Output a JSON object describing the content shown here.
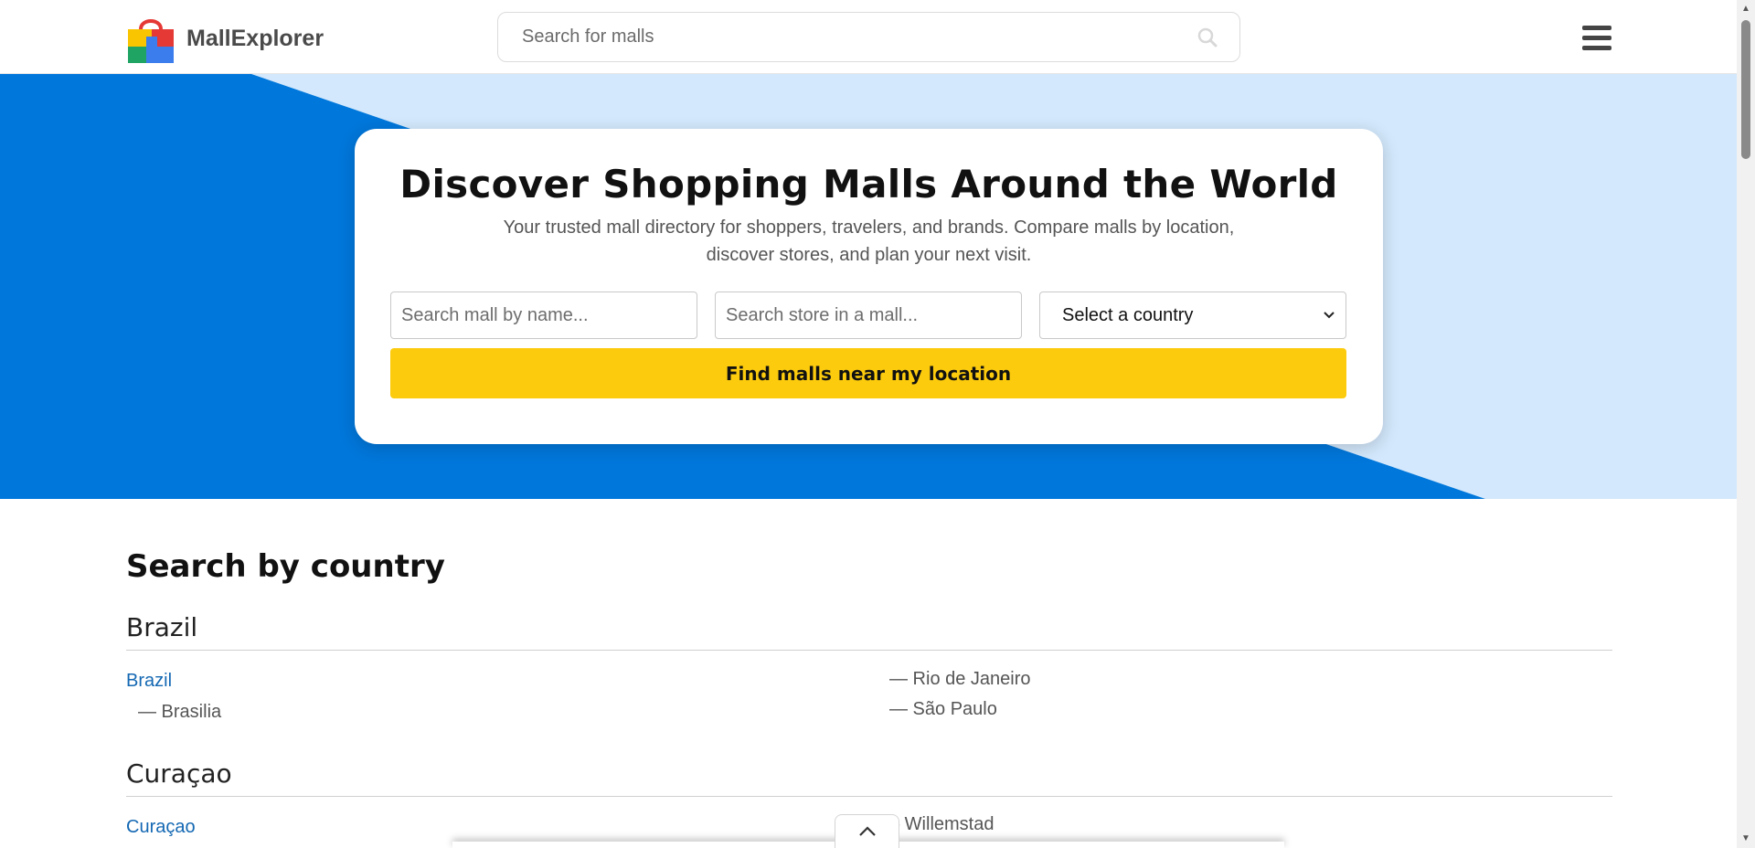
{
  "header": {
    "brand": "MallExplorer",
    "search_placeholder": "Search for malls"
  },
  "hero": {
    "title": "Discover Shopping Malls Around the World",
    "subtitle": "Your trusted mall directory for shoppers, travelers, and brands. Compare malls by location, discover stores, and plan your next visit.",
    "mall_name_placeholder": "Search mall by name...",
    "store_placeholder": "Search store in a mall...",
    "country_select": "Select a country",
    "find_button": "Find malls near my location"
  },
  "countries_section": {
    "heading": "Search by country",
    "countries": [
      {
        "name": "Brazil",
        "link": "Brazil",
        "cities": [
          "— Brasilia",
          "— Rio de Janeiro",
          "— São Paulo"
        ]
      },
      {
        "name": "Curaçao",
        "link": "Curaçao",
        "cities": [
          "– Willemstad"
        ]
      }
    ]
  },
  "colors": {
    "hero_blue": "#0077db",
    "hero_light": "#d3e8fc",
    "button_yellow": "#fccb0d",
    "link_blue": "#1468b3"
  }
}
